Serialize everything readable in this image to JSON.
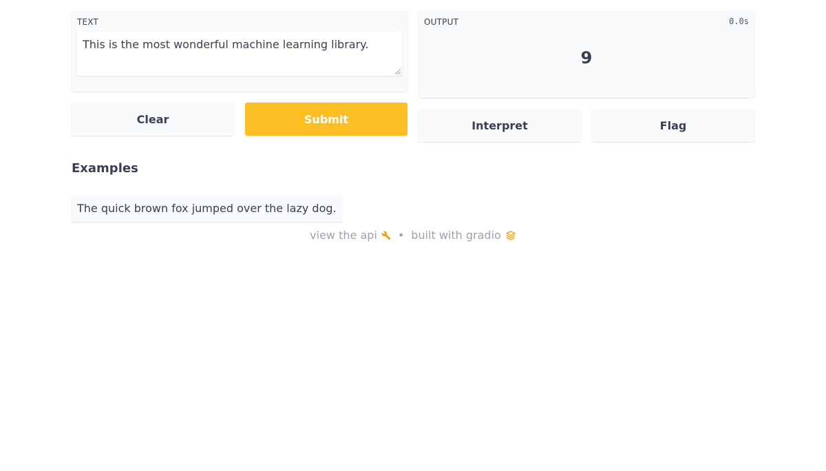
{
  "input": {
    "label": "TEXT",
    "value": "This is the most wonderful machine learning library."
  },
  "output": {
    "label": "OUTPUT",
    "timer": "0.0s",
    "value": "9"
  },
  "buttons": {
    "clear": "Clear",
    "submit": "Submit",
    "interpret": "Interpret",
    "flag": "Flag"
  },
  "examples": {
    "heading": "Examples",
    "items": [
      "The quick brown fox jumped over the lazy dog."
    ]
  },
  "footer": {
    "api_link": "view the api",
    "separator": "•",
    "built_with": "built with gradio"
  },
  "colors": {
    "primary": "#fbbf24",
    "panel": "#f9fafb",
    "text": "#374151",
    "muted": "#9ca3af",
    "icon_accent": "#f59e0b"
  },
  "icons": {
    "api": "wrench-icon",
    "gradio": "gradio-logo-icon"
  }
}
